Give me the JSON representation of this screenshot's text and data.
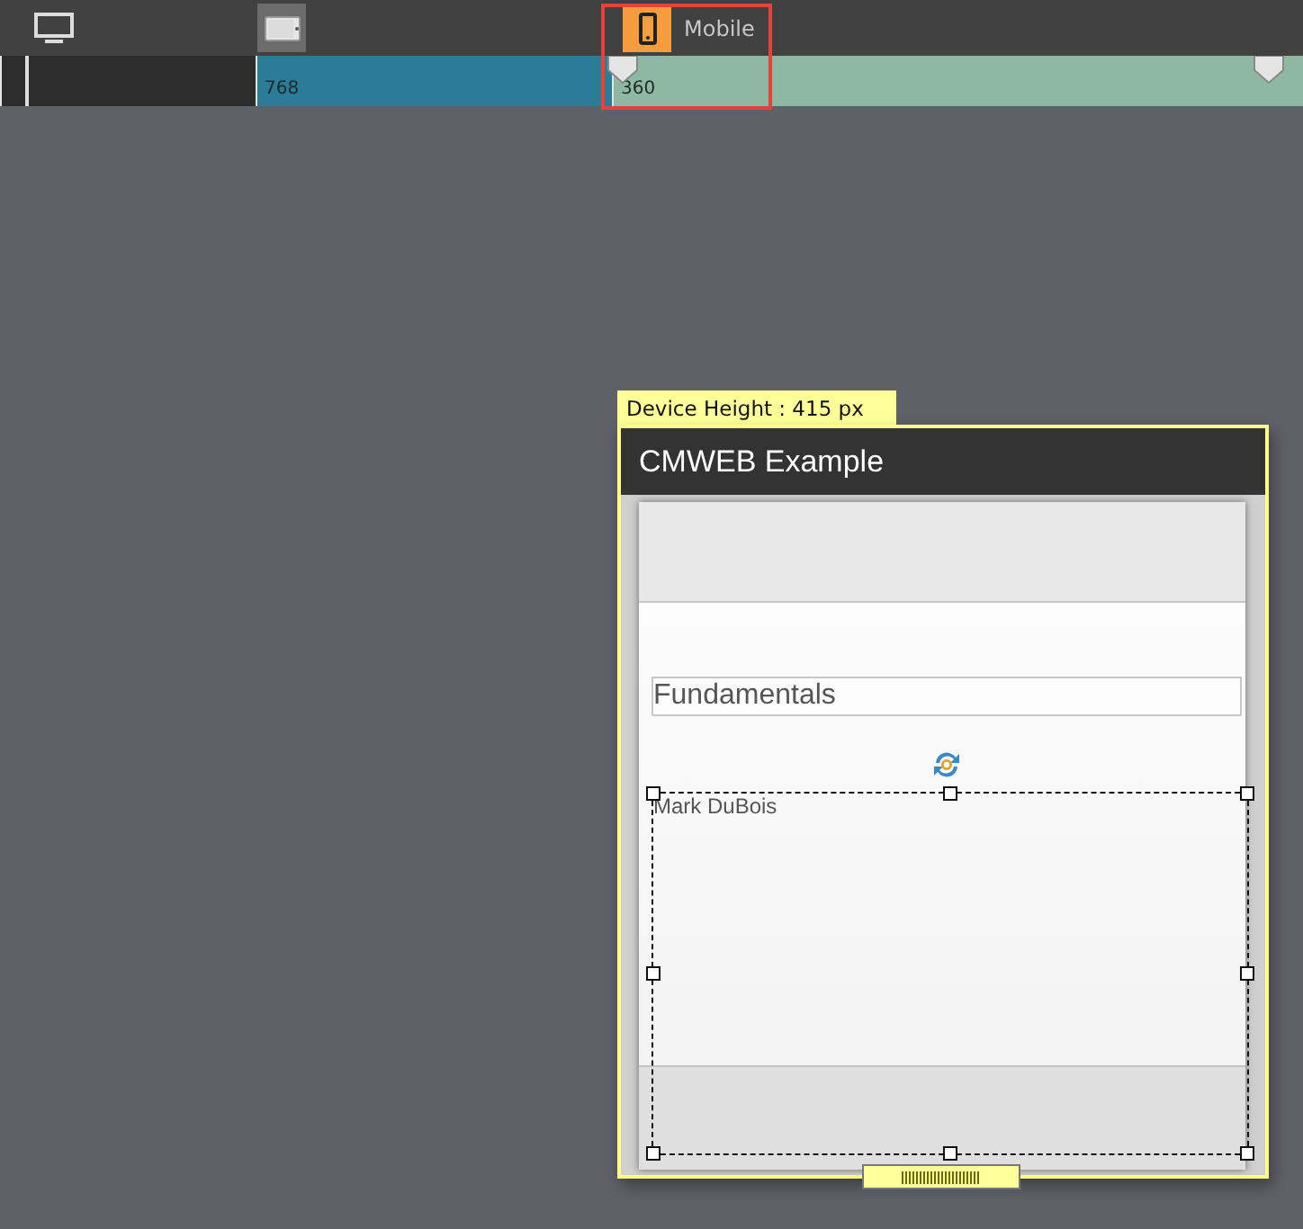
{
  "toolbar": {
    "devices": [
      {
        "kind": "desktop",
        "selected": false,
        "hovered": false
      },
      {
        "kind": "tablet",
        "selected": false,
        "hovered": true
      },
      {
        "kind": "mobile",
        "label": "Mobile",
        "selected": true,
        "hovered": false
      }
    ]
  },
  "ruler": {
    "segments": [
      {
        "kind": "desktop"
      },
      {
        "kind": "tablet",
        "label": "768"
      },
      {
        "kind": "mobile",
        "label": "360"
      }
    ]
  },
  "device": {
    "height_label": "Device Height : 415 px",
    "header_title": "CMWEB Example",
    "field_value": "Fundamentals",
    "selected_text": "Mark DuBois"
  }
}
